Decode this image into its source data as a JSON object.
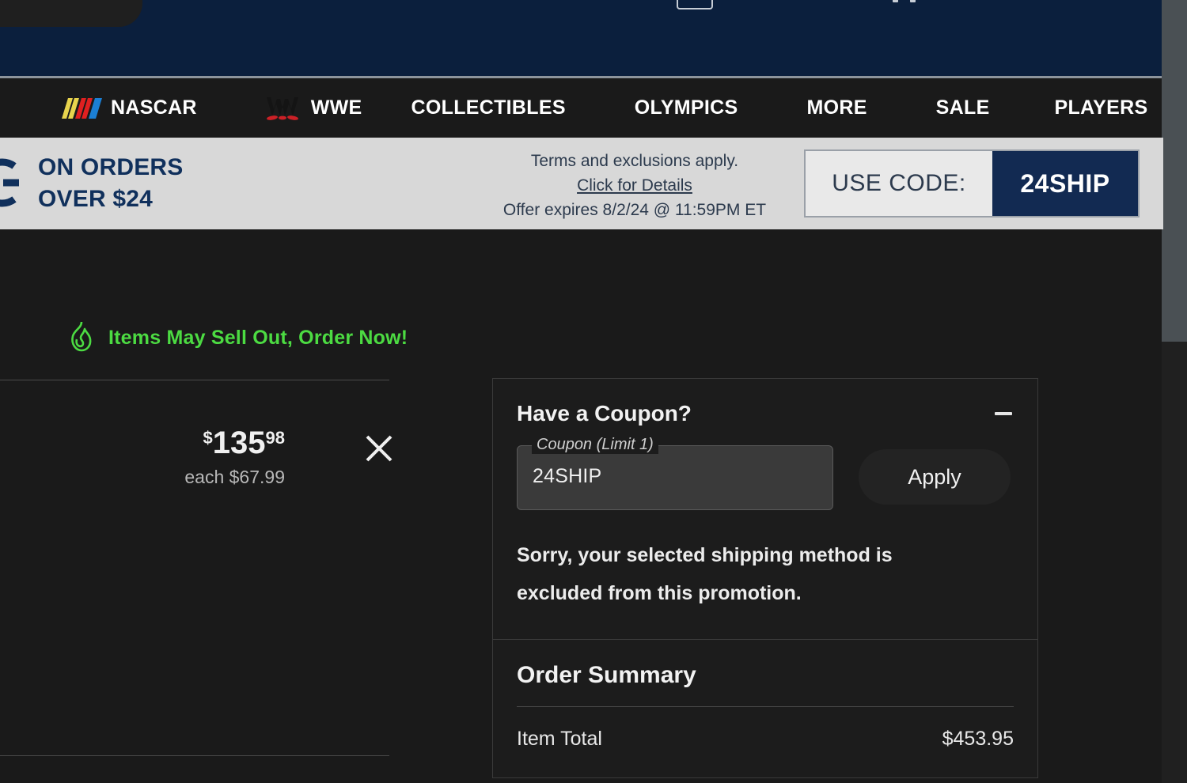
{
  "header": {
    "cart_icon": "cart-box-icon",
    "menu_dots_icon": "header-dots-icon"
  },
  "category_nav": {
    "items": [
      {
        "label": "NASCAR",
        "icon": "nascar-logo-icon"
      },
      {
        "label": "WWE",
        "icon": "wwe-logo-icon"
      },
      {
        "label": "COLLECTIBLES",
        "icon": ""
      },
      {
        "label": "OLYMPICS",
        "icon": ""
      },
      {
        "label": "MORE",
        "icon": ""
      },
      {
        "label": "SALE",
        "icon": ""
      },
      {
        "label": "PLAYERS",
        "icon": ""
      }
    ]
  },
  "promo_banner": {
    "logo_icon": "shipping-g-logo-icon",
    "headline_line1": "ON ORDERS",
    "headline_line2": "OVER $24",
    "terms_line": "Terms and exclusions apply.",
    "details_link": "Click for Details",
    "expiry_line": "Offer expires 8/2/24 @ 11:59PM ET",
    "use_code_label": "USE CODE:",
    "code_value": "24SHIP",
    "accent_navy": "#122a52",
    "background": "#d8d8d8"
  },
  "alerts": {
    "sell_out": "Items May Sell Out, Order Now!",
    "sell_out_color": "#4cdb42",
    "flame_icon": "flame-icon"
  },
  "cart_item": {
    "price_currency": "$",
    "price_dollars": "135",
    "price_cents": "98",
    "each_price": "each $67.99",
    "remove_icon": "close-x-icon"
  },
  "coupon": {
    "title": "Have a Coupon?",
    "collapse_icon": "minus-icon",
    "field_label": "Coupon (Limit 1)",
    "field_value": "24SHIP",
    "field_placeholder": "Coupon (Limit 1)",
    "apply_label": "Apply",
    "error_message": "Sorry, your selected shipping method is excluded from this promotion."
  },
  "order_summary": {
    "title": "Order Summary",
    "rows": [
      {
        "label": "Item Total",
        "value": "$453.95"
      }
    ]
  }
}
